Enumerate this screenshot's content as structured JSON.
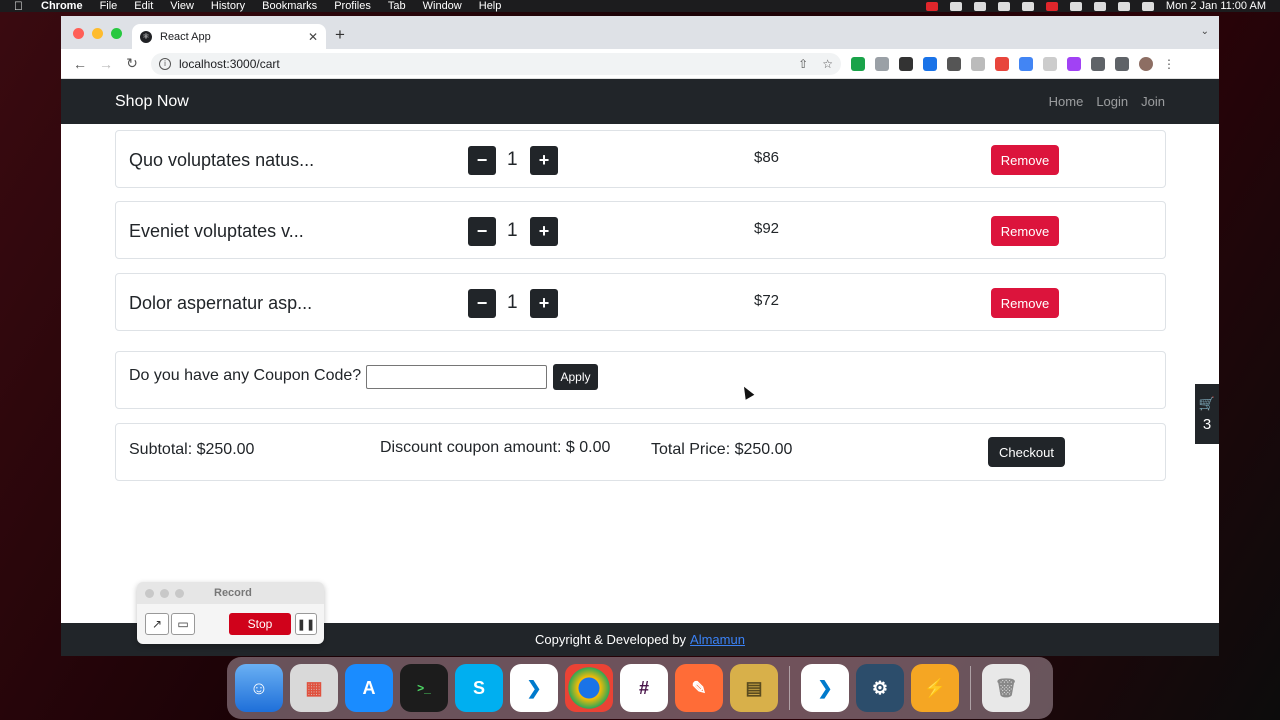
{
  "menubar": {
    "items": [
      "Chrome",
      "File",
      "Edit",
      "View",
      "History",
      "Bookmarks",
      "Profiles",
      "Tab",
      "Window",
      "Help"
    ],
    "datetime": "Mon 2 Jan  11:00 AM"
  },
  "browser": {
    "tab_title": "React App",
    "url": "localhost:3000/cart"
  },
  "navbar": {
    "brand": "Shop Now",
    "links": [
      "Home",
      "Login",
      "Join"
    ]
  },
  "cart": {
    "items": [
      {
        "name": "Quo voluptates natus...",
        "minus": "−",
        "qty": "1",
        "plus": "+",
        "price": "$86",
        "remove": "Remove"
      },
      {
        "name": "Eveniet voluptates v...",
        "minus": "−",
        "qty": "1",
        "plus": "+",
        "price": "$92",
        "remove": "Remove"
      },
      {
        "name": "Dolor aspernatur asp...",
        "minus": "−",
        "qty": "1",
        "plus": "+",
        "price": "$72",
        "remove": "Remove"
      }
    ],
    "coupon": {
      "label": "Do you have any Coupon Code?",
      "value": "",
      "apply": "Apply"
    },
    "summary": {
      "subtotal": "Subtotal: $250.00",
      "discount": "Discount coupon amount: $ 0.00",
      "total": "Total Price: $250.00",
      "checkout": "Checkout"
    },
    "badge_count": "3"
  },
  "footer": {
    "text": "Copyright & Developed by",
    "link": "Almamun"
  },
  "record_widget": {
    "title": "Record",
    "stop": "Stop"
  },
  "dock": {
    "apps": [
      "finder-icon",
      "launchpad-icon",
      "app-store-icon",
      "terminal-icon",
      "skype-icon",
      "vscode-icon",
      "chrome-icon",
      "slack-icon",
      "postman-icon",
      "archive-utility-icon",
      "vscode-icon",
      "mysql-workbench-icon",
      "reeder-icon",
      "trash-icon"
    ]
  },
  "colors": {
    "navbar_bg": "#212529",
    "remove_button": "#dc143c",
    "footer_link": "#3b82f6",
    "stop_button": "#d0021b"
  }
}
